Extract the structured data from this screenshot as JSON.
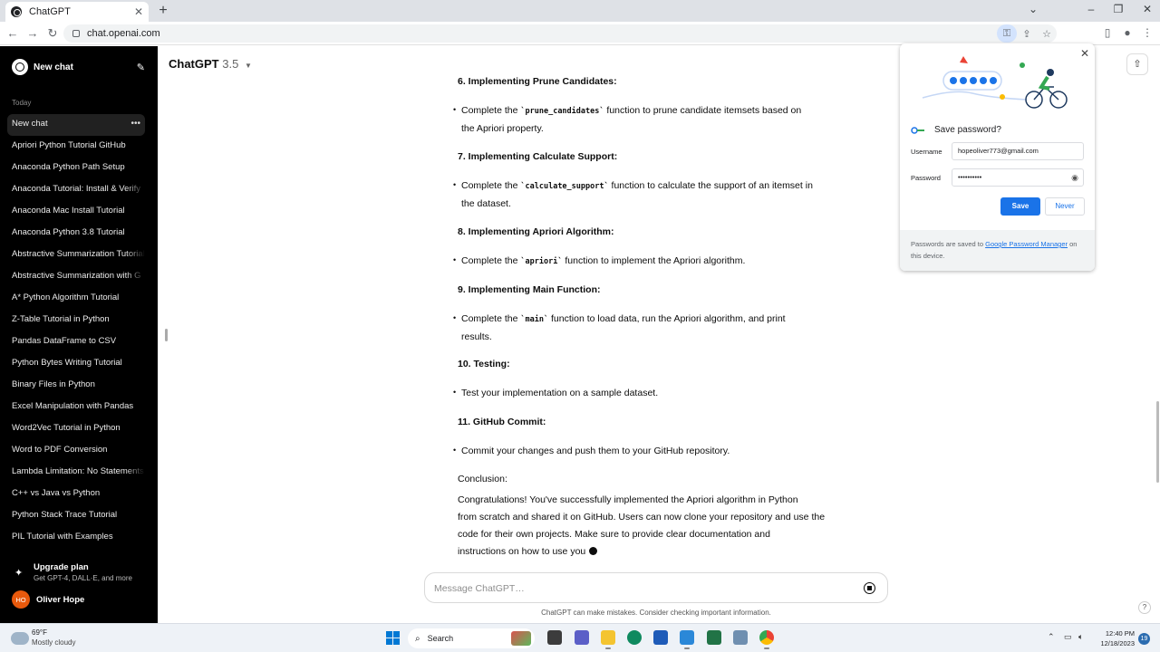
{
  "browser": {
    "tab_title": "ChatGPT",
    "url": "chat.openai.com"
  },
  "sidebar": {
    "new_chat": "New chat",
    "section": "Today",
    "items": [
      {
        "label": "New chat"
      },
      {
        "label": "Apriori Python Tutorial GitHub"
      },
      {
        "label": "Anaconda Python Path Setup"
      },
      {
        "label": "Anaconda Tutorial: Install & Verify"
      },
      {
        "label": "Anaconda Mac Install Tutorial"
      },
      {
        "label": "Anaconda Python 3.8 Tutorial"
      },
      {
        "label": "Abstractive Summarization Tutorial"
      },
      {
        "label": "Abstractive Summarization with G"
      },
      {
        "label": "A* Python Algorithm Tutorial"
      },
      {
        "label": "Z-Table Tutorial in Python"
      },
      {
        "label": "Pandas DataFrame to CSV"
      },
      {
        "label": "Python Bytes Writing Tutorial"
      },
      {
        "label": "Binary Files in Python"
      },
      {
        "label": "Excel Manipulation with Pandas"
      },
      {
        "label": "Word2Vec Tutorial in Python"
      },
      {
        "label": "Word to PDF Conversion"
      },
      {
        "label": "Lambda Limitation: No Statements"
      },
      {
        "label": "C++ vs Java vs Python"
      },
      {
        "label": "Python Stack Trace Tutorial"
      },
      {
        "label": "PIL Tutorial with Examples"
      }
    ],
    "upgrade_title": "Upgrade plan",
    "upgrade_sub": "Get GPT-4, DALL·E, and more",
    "user_initials": "HO",
    "user_name": "Oliver Hope"
  },
  "header": {
    "model": "ChatGPT",
    "version": "3.5"
  },
  "content": {
    "h6": "6. Implementing Prune Candidates:",
    "b6_pre": "Complete the ",
    "b6_code": "`prune_candidates`",
    "b6_post": " function to prune candidate itemsets based on",
    "b6_line2": "the Apriori property.",
    "h7": "7. Implementing Calculate Support:",
    "b7_pre": "Complete the ",
    "b7_code": "`calculate_support`",
    "b7_post": " function to calculate the support of an itemset in",
    "b7_line2": "the dataset.",
    "h8": "8. Implementing Apriori Algorithm:",
    "b8_pre": "Complete the ",
    "b8_code": "`apriori`",
    "b8_post": " function to implement the Apriori algorithm.",
    "h9": "9. Implementing Main Function:",
    "b9_pre": "Complete the ",
    "b9_code": "`main`",
    "b9_post": " function to load data, run the Apriori algorithm, and print",
    "b9_line2": "results.",
    "h10": "10. Testing:",
    "b10": "Test your implementation on a sample dataset.",
    "h11": "11. GitHub Commit:",
    "b11": "Commit your changes and push them to your GitHub repository.",
    "conclusion_label": "Conclusion:",
    "conclusion_l1": "Congratulations! You've successfully implemented the Apriori algorithm in Python",
    "conclusion_l2": "from scratch and shared it on GitHub. Users can now clone your repository and use the",
    "conclusion_l3": "code for their own projects. Make sure to provide clear documentation and",
    "conclusion_l4": "instructions on how to use you"
  },
  "composer": {
    "placeholder": "Message ChatGPT…",
    "disclaimer": "ChatGPT can make mistakes. Consider checking important information.",
    "help": "?"
  },
  "password_popup": {
    "title": "Save password?",
    "username_label": "Username",
    "username_value": "hopeoliver773@gmail.com",
    "password_label": "Password",
    "password_value": "••••••••••",
    "save": "Save",
    "never": "Never",
    "footer_pre": "Passwords are saved to ",
    "footer_link": "Google Password Manager",
    "footer_post": " on this device."
  },
  "taskbar": {
    "temp": "69°F",
    "weather": "Mostly cloudy",
    "search": "Search",
    "time": "12:40 PM",
    "date": "12/18/2023",
    "notifications": "19"
  },
  "colors": {
    "sidebar_bg": "#000000",
    "accent_blue": "#1a73e8",
    "avatar_orange": "#e8590c"
  }
}
